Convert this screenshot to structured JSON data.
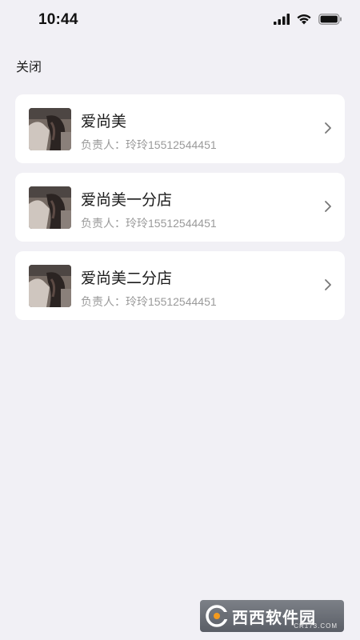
{
  "status_bar": {
    "time": "10:44"
  },
  "nav": {
    "close_label": "关闭"
  },
  "stores": [
    {
      "name": "爱尚美",
      "manager": "负责人：玲玲15512544451"
    },
    {
      "name": "爱尚美一分店",
      "manager": "负责人：玲玲15512544451"
    },
    {
      "name": "爱尚美二分店",
      "manager": "负责人：玲玲15512544451"
    }
  ],
  "watermark": {
    "text": "西西软件园",
    "sub": "CR173.COM"
  },
  "icons": {
    "signal": "cellular-signal-icon",
    "wifi": "wifi-icon",
    "battery": "battery-icon",
    "chevron": "chevron-right-icon"
  }
}
